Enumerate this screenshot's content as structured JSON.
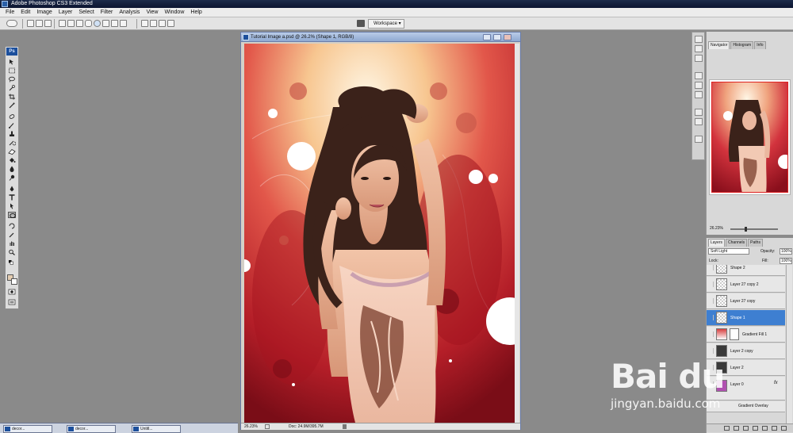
{
  "app": {
    "title": "Adobe Photoshop CS3 Extended"
  },
  "menu": [
    "File",
    "Edit",
    "Image",
    "Layer",
    "Select",
    "Filter",
    "Analysis",
    "View",
    "Window",
    "Help"
  ],
  "options": {
    "workspace_label": "Workspace ▾"
  },
  "toolbox": {
    "logo": "Ps",
    "foreground_color": "#e2cbb0",
    "background_color": "#ffffff"
  },
  "document": {
    "title": "Tutorial Image a.psd @ 26.2% (Shape 1, RGB/8)",
    "zoom": "26.23%",
    "doc_info": "Doc: 24.9M/395.7M"
  },
  "navigator": {
    "tabs": [
      "Navigator",
      "Histogram",
      "Info"
    ],
    "zoom": "26.23%"
  },
  "layers": {
    "tabs": [
      "Layers",
      "Channels",
      "Paths"
    ],
    "blend_mode": "Soft Light",
    "opacity_label": "Opacity:",
    "opacity": "100%",
    "lock_label": "Lock:",
    "fill_label": "Fill:",
    "fill": "100%",
    "items": [
      {
        "name": "Shape 2"
      },
      {
        "name": "Layer 27 copy 2"
      },
      {
        "name": "Layer 27 copy"
      },
      {
        "name": "Shape 1",
        "selected": true
      },
      {
        "name": "Gradient Fill 1"
      },
      {
        "name": "Layer 2 copy"
      },
      {
        "name": "Layer 2"
      },
      {
        "name": "Layer 0",
        "fx": "fx"
      },
      {
        "name": "Gradient Overlay"
      }
    ]
  },
  "taskbar": {
    "items": [
      "decor...",
      "decor...",
      "Untitl..."
    ]
  },
  "watermark": {
    "logo": "Bai du",
    "url": "jingyan.baidu.com"
  },
  "colors": {
    "accent": "#3e7fd1",
    "titlebar": "#0b1430",
    "canvas_red": "#c53a3a"
  }
}
